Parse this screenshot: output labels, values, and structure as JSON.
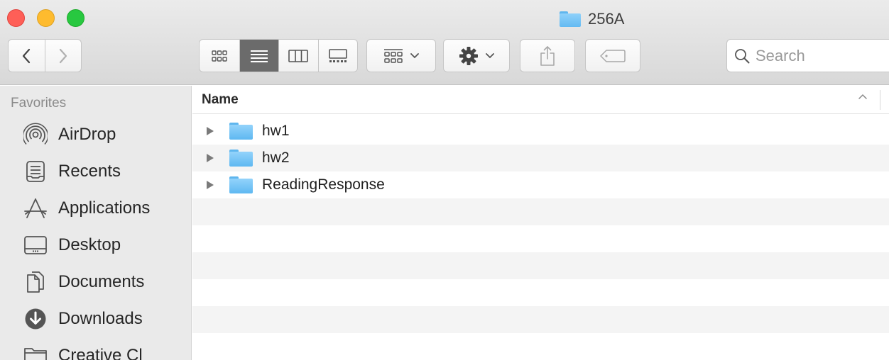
{
  "window": {
    "title": "256A",
    "controls": [
      "close",
      "minimize",
      "zoom"
    ]
  },
  "toolbar": {
    "back_icon": "chevron-left-icon",
    "forward_icon": "chevron-right-icon",
    "view_modes": [
      {
        "name": "icon-view",
        "active": false
      },
      {
        "name": "list-view",
        "active": true
      },
      {
        "name": "column-view",
        "active": false
      },
      {
        "name": "gallery-view",
        "active": false
      }
    ],
    "arrange_icon": "group-icon",
    "action_icon": "gear-icon",
    "share_icon": "share-icon",
    "tag_icon": "tag-icon",
    "search": {
      "placeholder": "Search",
      "value": ""
    }
  },
  "sidebar": {
    "heading": "Favorites",
    "items": [
      {
        "label": "AirDrop",
        "icon": "airdrop-icon"
      },
      {
        "label": "Recents",
        "icon": "recents-icon"
      },
      {
        "label": "Applications",
        "icon": "applications-icon"
      },
      {
        "label": "Desktop",
        "icon": "desktop-icon"
      },
      {
        "label": "Documents",
        "icon": "documents-icon"
      },
      {
        "label": "Downloads",
        "icon": "downloads-icon"
      },
      {
        "label": "Creative Cl",
        "icon": "folder-icon"
      }
    ]
  },
  "list": {
    "column_name": "Name",
    "sort_direction": "ascending",
    "rows": [
      {
        "name": "hw1",
        "kind": "folder",
        "expanded": false
      },
      {
        "name": "hw2",
        "kind": "folder",
        "expanded": false
      },
      {
        "name": "ReadingResponse",
        "kind": "folder",
        "expanded": false
      }
    ]
  },
  "colors": {
    "folder": "#63baf2",
    "active_view": "#6b6b6b",
    "sidebar_bg": "#eaeaea",
    "stripe": "#f4f4f4"
  }
}
